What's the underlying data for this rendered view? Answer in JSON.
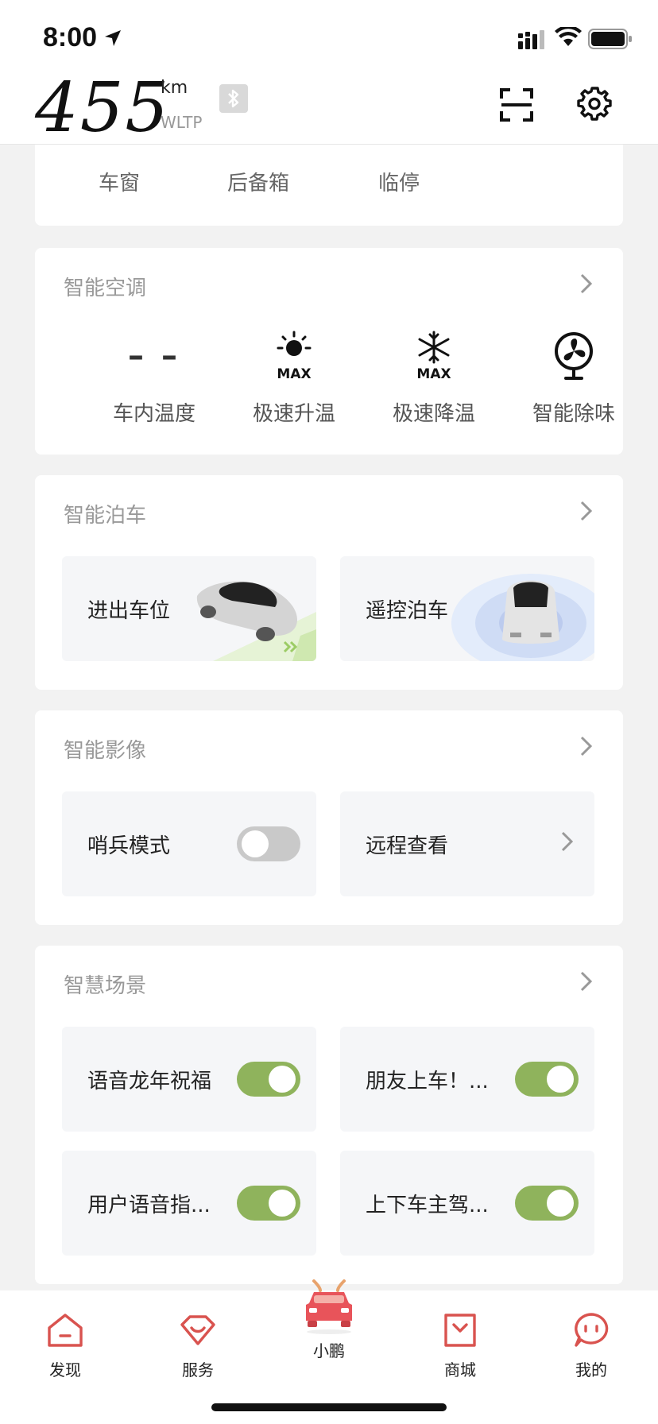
{
  "status_bar": {
    "time": "8:00"
  },
  "header": {
    "range_value": "455",
    "range_unit": "km",
    "range_standard": "WLTP"
  },
  "quick_controls": {
    "items": [
      "车窗",
      "后备箱",
      "临停"
    ]
  },
  "smart_ac": {
    "title": "智能空调",
    "cabin_temp_value": "– –",
    "items": [
      {
        "label": "车内温度",
        "icon": "thermometer-dash"
      },
      {
        "label": "极速升温",
        "icon": "sun-max-icon",
        "badge": "MAX"
      },
      {
        "label": "极速降温",
        "icon": "snowflake-max-icon",
        "badge": "MAX"
      },
      {
        "label": "智能除味",
        "icon": "fan-icon"
      }
    ]
  },
  "smart_parking": {
    "title": "智能泊车",
    "tiles": [
      {
        "label": "进出车位"
      },
      {
        "label": "遥控泊车"
      }
    ]
  },
  "smart_imaging": {
    "title": "智能影像",
    "tiles": [
      {
        "label": "哨兵模式",
        "toggle": "off"
      },
      {
        "label": "远程查看"
      }
    ]
  },
  "smart_scenes": {
    "title": "智慧场景",
    "tiles": [
      {
        "label": "语音龙年祝福",
        "toggle": "on"
      },
      {
        "label": "朋友上车！...",
        "toggle": "on"
      },
      {
        "label": "用户语音指...",
        "toggle": "on"
      },
      {
        "label": "上下车主驾...",
        "toggle": "on"
      }
    ]
  },
  "tabbar": {
    "items": [
      {
        "label": "发现"
      },
      {
        "label": "服务"
      },
      {
        "label": "小鹏"
      },
      {
        "label": "商城"
      },
      {
        "label": "我的"
      }
    ]
  },
  "colors": {
    "toggle_on": "#8fb35c",
    "toggle_off": "#c9c9c9",
    "tab_accent": "#d9534f",
    "background": "#f2f2f2"
  }
}
